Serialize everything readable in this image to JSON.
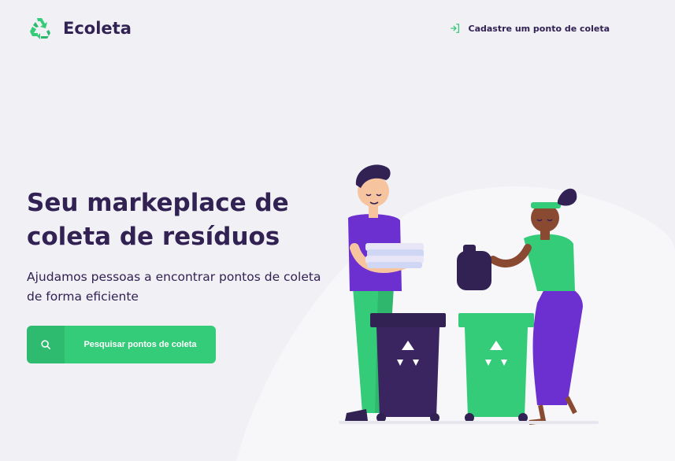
{
  "header": {
    "brand": "Ecoleta",
    "logo_icon": "recycle-icon",
    "register_link": {
      "label": "Cadastre um ponto de coleta",
      "icon": "login-icon"
    }
  },
  "hero": {
    "title": "Seu markeplace de coleta de resíduos",
    "description": "Ajudamos pessoas a encontrar pontos de coleta de forma eficiente",
    "search_button": {
      "label": "Pesquisar pontos de coleta",
      "icon": "search-icon"
    }
  },
  "colors": {
    "primary": "#34cb79",
    "title": "#322153",
    "background": "#f0f0f5",
    "accent_purple": "#6c2fd0"
  }
}
